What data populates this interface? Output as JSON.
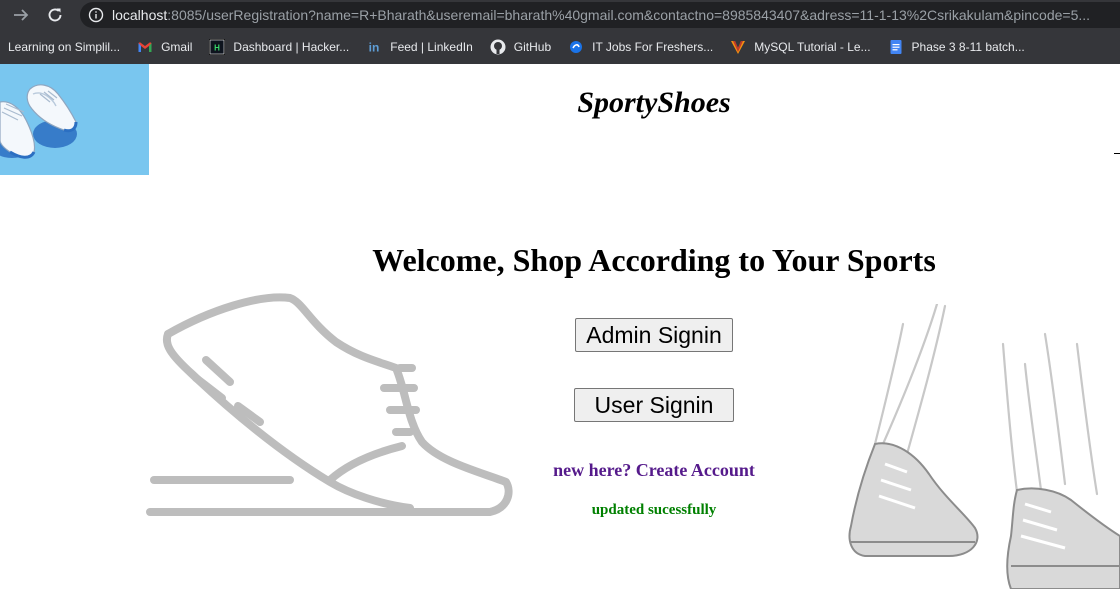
{
  "browser": {
    "url_host": "localhost",
    "url_rest": ":8085/userRegistration?name=R+Bharath&useremail=bharath%40gmail.com&contactno=8985843407&adress=11-1-13%2Csrikakulam&pincode=5...",
    "bookmarks": [
      {
        "label": "Learning on Simplil...",
        "icon": "none"
      },
      {
        "label": "Gmail",
        "icon": "gmail-icon"
      },
      {
        "label": "Dashboard | Hacker...",
        "icon": "hackerrank-icon"
      },
      {
        "label": "Feed | LinkedIn",
        "icon": "linkedin-icon"
      },
      {
        "label": "GitHub",
        "icon": "github-icon"
      },
      {
        "label": "IT Jobs For Freshers...",
        "icon": "globe-icon"
      },
      {
        "label": "MySQL Tutorial - Le...",
        "icon": "mysql-icon"
      },
      {
        "label": "Phase 3 8-11 batch...",
        "icon": "docs-icon"
      }
    ]
  },
  "header": {
    "brand": "SportyShoes"
  },
  "main": {
    "welcome": "Welcome, Shop According to Your Sports",
    "admin_signin": "Admin Signin",
    "user_signin": "User Signin",
    "create_account": "new here? Create Account",
    "status_message": "updated sucessfully"
  },
  "colors": {
    "link": "#551a8b",
    "status": "#008000",
    "logo_bg": "#79c6ef"
  }
}
